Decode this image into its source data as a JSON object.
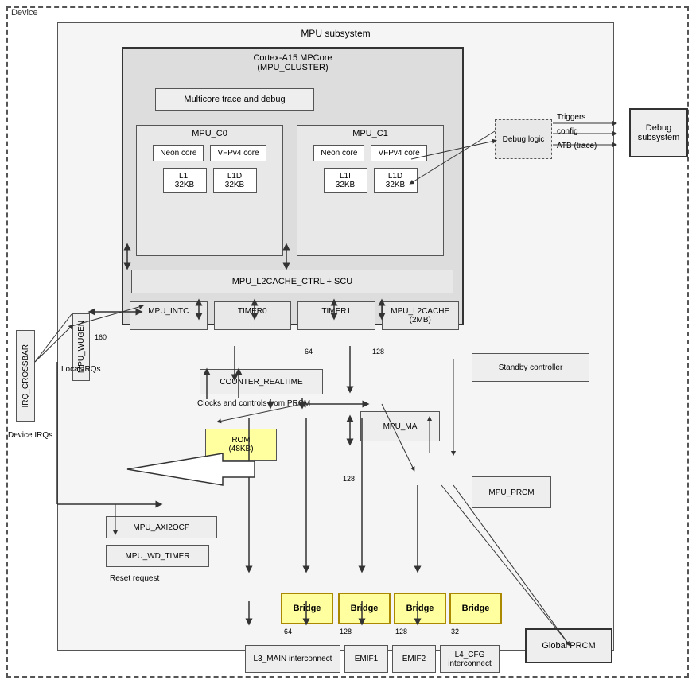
{
  "device": {
    "label": "Device",
    "mpu_subsystem": {
      "label": "MPU subsystem",
      "cluster": {
        "label_line1": "Cortex-A15 MPCore",
        "label_line2": "(MPU_CLUSTER)",
        "multicore_trace": "Multicore trace and debug",
        "mpu_c0": {
          "label": "MPU_C0",
          "neon_core": "Neon core",
          "vfpv4_core": "VFPv4 core",
          "l1i": "L1I\n32KB",
          "l1d": "L1D\n32KB"
        },
        "mpu_c1": {
          "label": "MPU_C1",
          "neon_core": "Neon core",
          "vfpv4_core": "VFPv4 core",
          "l1i": "L1I\n32KB",
          "l1d": "L1D\n32KB"
        },
        "l2cache": "MPU_L2CACHE_CTRL + SCU",
        "mpu_intc": "MPU_INTC",
        "timer0": "TIMER0",
        "timer1": "TIMER1",
        "mpu_l2cache_2mb": "MPU_L2CACHE\n(2MB)"
      },
      "irq_crossbar": "IRQ_CROSSBAR",
      "mpu_wugen": "MPU_WUGEN",
      "bus_160": "160",
      "local_irqs": "Local IRQs",
      "device_irqs": "Device IRQs",
      "counter_realtime": "COUNTER_REALTIME",
      "clocks_controls": "Clocks and controls\nfrom PRCM",
      "rom": "ROM\n(48KB)",
      "mpu_ma": "MPU_MA",
      "mpu_axicocp": "MPU_AXI2OCP",
      "mpu_wd_timer": "MPU_WD_TIMER",
      "reset_request": "Reset\nrequest",
      "mpu_prcm": "MPU_PRCM",
      "standby_controller": "Standby controller",
      "global_prcm": "Global PRCM",
      "bridges": [
        "Bridge",
        "Bridge",
        "Bridge",
        "Bridge"
      ],
      "bus_64_1": "64",
      "bus_128_1": "128",
      "bus_128_2": "128",
      "bus_128_3": "128",
      "bus_128_4": "128",
      "bus_32": "32",
      "bus_64_2": "64",
      "l3_interconnect": "L3_MAIN interconnect",
      "emif1": "EMIF1",
      "emif2": "EMIF2",
      "l4_cfg_interconnect": "L4_CFG\ninterconnect",
      "triggers": "Triggers",
      "config": "config",
      "atb_trace": "ATB (trace)",
      "debug_logic": "Debug\nlogic",
      "debug_subsystem": "Debug\nsubsystem"
    }
  }
}
